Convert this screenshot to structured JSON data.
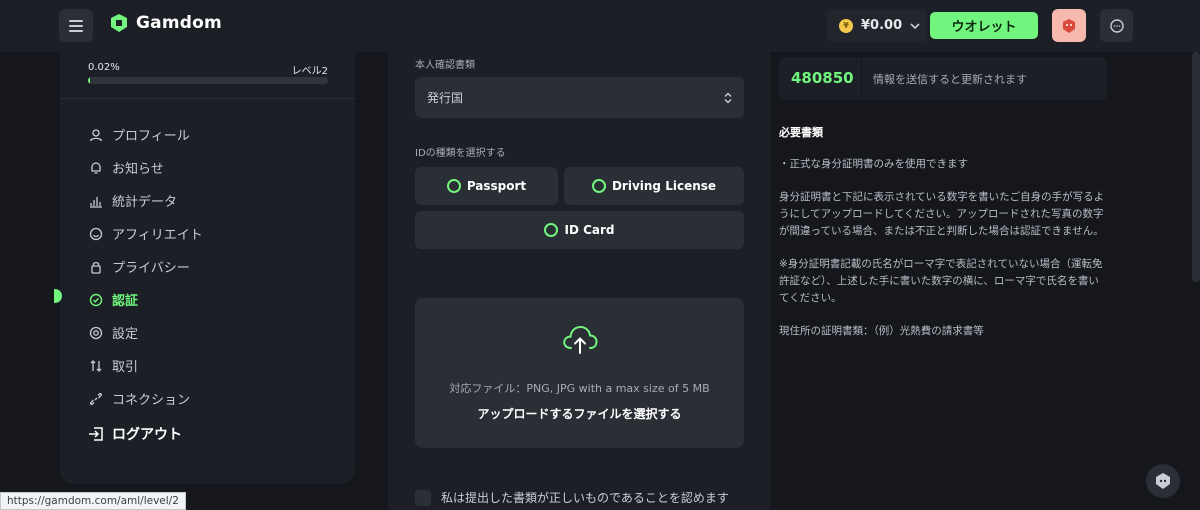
{
  "header": {
    "logo_text": "Gamdom",
    "balance": "¥0.00",
    "wallet_label": "ウオレット"
  },
  "sidebar": {
    "progress_percent": "0.02%",
    "progress_value": 0.0002,
    "level_label": "レベル2",
    "items": [
      {
        "label": "プロフィール",
        "icon": "user-icon"
      },
      {
        "label": "お知らせ",
        "icon": "bell-icon"
      },
      {
        "label": "統計データ",
        "icon": "bar-chart-icon"
      },
      {
        "label": "アフィリエイト",
        "icon": "smile-icon"
      },
      {
        "label": "プライバシー",
        "icon": "lock-icon"
      },
      {
        "label": "認証",
        "icon": "check-circle-icon",
        "active": true
      },
      {
        "label": "設定",
        "icon": "gear-icon"
      },
      {
        "label": "取引",
        "icon": "swap-icon"
      },
      {
        "label": "コネクション",
        "icon": "link-icon"
      }
    ],
    "logout_label": "ログアウト"
  },
  "form": {
    "document_label": "本人確認書類",
    "country_select": "発行国",
    "id_type_label": "IDの種類を選択する",
    "id_options": [
      "Passport",
      "Driving License",
      "ID Card"
    ],
    "upload_hint": "対応ファイル：PNG, JPG with a max size of 5 MB",
    "upload_cta": "アップロードするファイルを選択する",
    "confirm_text": "私は提出した書類が正しいものであることを認めます"
  },
  "info": {
    "code": "480850",
    "code_note": "情報を送信すると更新されます",
    "requirements_title": "必要書類",
    "paragraphs": [
      "・正式な身分証明書のみを使用できます",
      "身分証明書と下記に表示されている数字を書いたご自身の手が写るようにしてアップロードしてください。アップロードされた写真の数字が間違っている場合、または不正と判断した場合は認証できません。",
      "※身分証明書記載の氏名がローマ字で表記されていない場合（運転免許証など）、上述した手に書いた数字の横に、ローマ字で氏名を書いてください。",
      "現住所の証明書類：（例）光熱費の請求書等"
    ]
  },
  "status_bar": {
    "url": "https://gamdom.com/aml/level/2"
  },
  "colors": {
    "accent": "#72f57e",
    "background": "#15171c",
    "panel": "#1c1f25",
    "control": "#2a2e35"
  }
}
